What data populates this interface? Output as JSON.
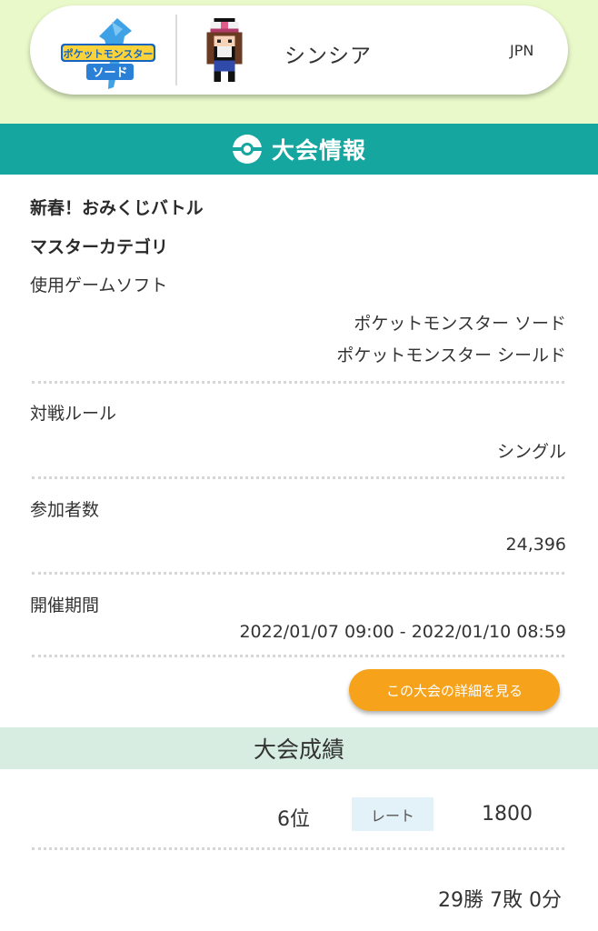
{
  "player": {
    "game_logo_text": "ポケットモンスター ソード",
    "name": "シンシア",
    "region": "JPN"
  },
  "tournament_section": {
    "title": "大会情報",
    "name": "新春！おみくじバトル",
    "category": "マスターカテゴリ",
    "software_label": "使用ゲームソフト",
    "software_values": [
      "ポケットモンスター ソード",
      "ポケットモンスター シールド"
    ],
    "rule_label": "対戦ルール",
    "rule_value": "シングル",
    "participants_label": "参加者数",
    "participants_value": "24,396",
    "period_label": "開催期間",
    "period_value": "2022/01/07 09:00 - 2022/01/10 08:59",
    "detail_button_label": "この大会の詳細を見る"
  },
  "results_section": {
    "title": "大会成績",
    "rank": "6位",
    "rate_label": "レート",
    "rate_value": "1800",
    "record": "29勝 7敗 0分"
  },
  "colors": {
    "top_background": "#e9f9c9",
    "header_teal": "#14a69f",
    "button_orange": "#f6a31b",
    "results_header": "#d7ede2",
    "rate_badge": "#e3f2f9"
  },
  "icons": [
    "sword-logo",
    "trainer-sprite-icon",
    "pokeball-icon"
  ]
}
